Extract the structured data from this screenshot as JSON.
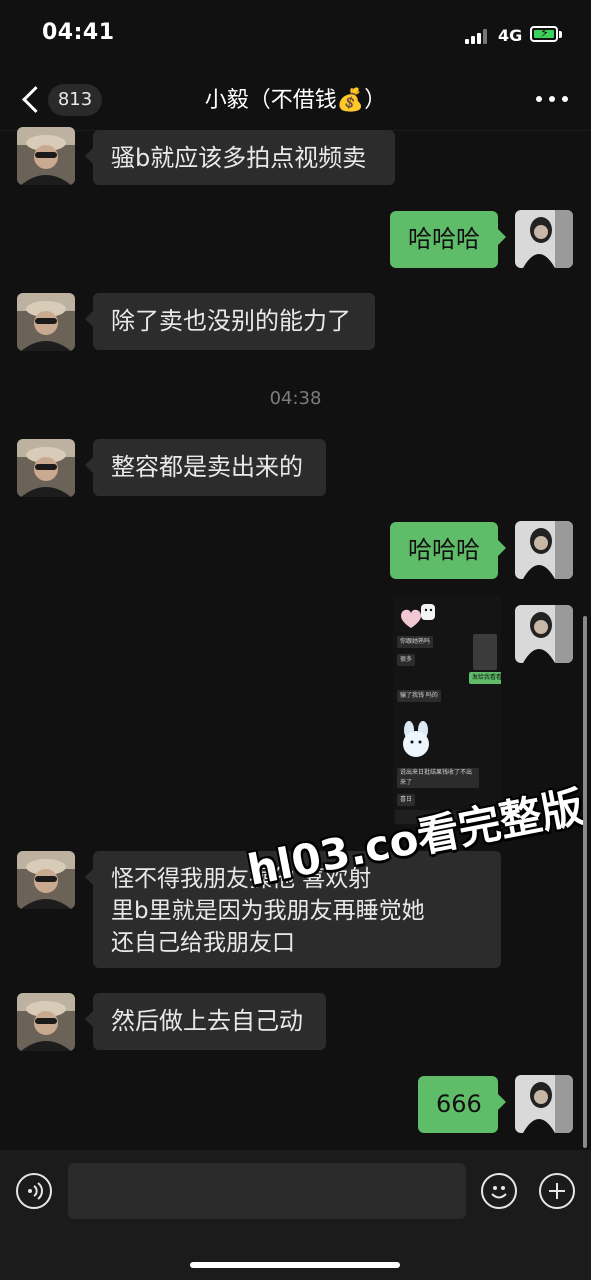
{
  "status_bar": {
    "time": "04:41",
    "network": "4G",
    "battery_icon": "battery-charging-icon"
  },
  "nav": {
    "unread_count": "813",
    "title": "小毅（不借钱💰）",
    "back_icon": "chevron-left-icon",
    "more_icon": "more-icon"
  },
  "messages": {
    "m1": {
      "text": "骚b就应该多拍点视频卖",
      "side": "incoming"
    },
    "m2": {
      "text": "哈哈哈",
      "side": "outgoing"
    },
    "m3": {
      "text": "除了卖也没别的能力了",
      "side": "incoming"
    },
    "timestamp": "04:38",
    "m4": {
      "text": "整容都是卖出来的",
      "side": "incoming"
    },
    "m5": {
      "text": "哈哈哈",
      "side": "outgoing"
    },
    "m6": {
      "type": "image",
      "side": "outgoing",
      "lines": [
        "你跟她熟吗",
        "很多",
        "发给我看看",
        "骗了我钱 吗的",
        "说出来日批结果钱收了不出来了",
        "喜日"
      ]
    },
    "m7": {
      "text": "怪不得我朋友操他 喜欢射\n里b里就是因为我朋友再睡觉她\n还自己给我朋友口",
      "side": "incoming"
    },
    "m8": {
      "text": "然后做上去自己动",
      "side": "incoming"
    },
    "m9": {
      "text": "666",
      "side": "outgoing"
    }
  },
  "watermark": "hl03.co看完整版",
  "input_bar": {
    "voice_icon": "voice-icon",
    "emoji_icon": "emoji-icon",
    "add_icon": "plus-icon",
    "placeholder": ""
  },
  "colors": {
    "background": "#111111",
    "incoming_bubble": "#2c2c2c",
    "outgoing_bubble": "#5fbd6a"
  }
}
